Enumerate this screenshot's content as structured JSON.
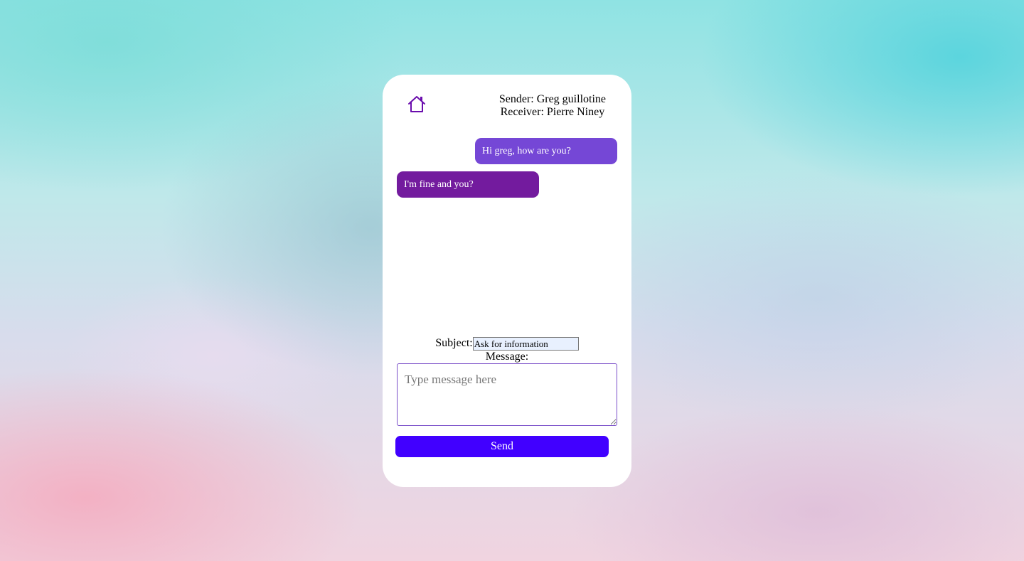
{
  "header": {
    "home_icon": "home-icon",
    "sender": "Sender: Greg guillotine",
    "receiver": "Receiver: Pierre Niney"
  },
  "messages": [
    {
      "text": "Hi greg, how are you?",
      "direction": "sent",
      "color": "#7547d6"
    },
    {
      "text": "I'm fine and you?",
      "direction": "received",
      "color": "#731b9e"
    }
  ],
  "form": {
    "subject_label": "Subject:",
    "subject_value": "Ask for information",
    "message_label": "Message:",
    "message_placeholder": "Type message here",
    "send_label": "Send"
  },
  "colors": {
    "accent": "#4100ff",
    "icon": "#6a0dad"
  }
}
